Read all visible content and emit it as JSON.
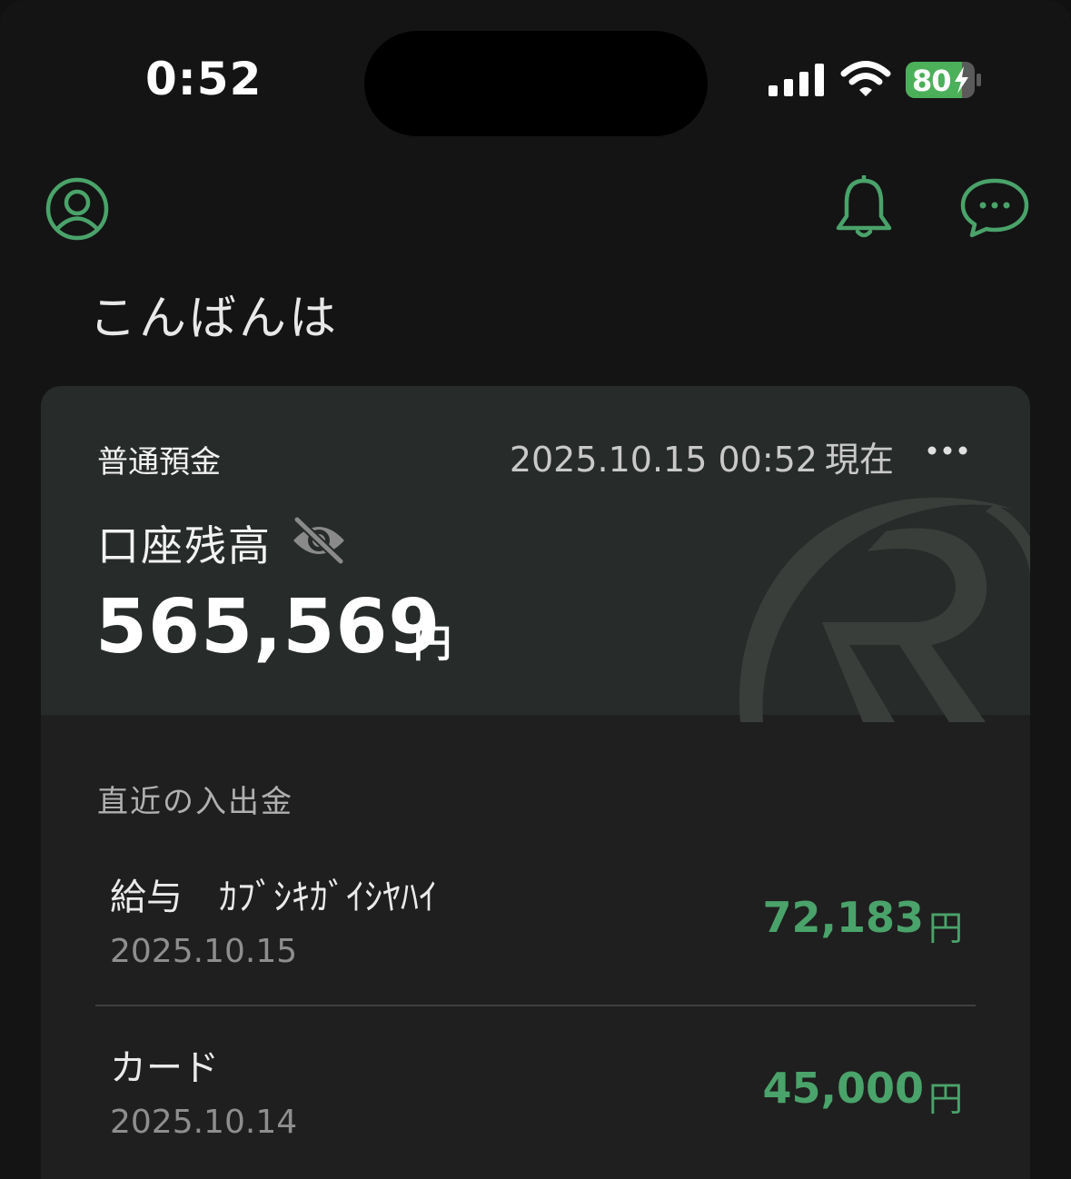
{
  "status_bar": {
    "time": "0:52",
    "battery_level": "80",
    "battery_charging": true
  },
  "header": {
    "greeting": "こんばんは"
  },
  "icons": {
    "profile": "person-circle-icon",
    "notifications": "bell-icon",
    "messages": "chat-bubble-icon",
    "more": "more-dots-icon",
    "hide_balance": "eye-slash-icon"
  },
  "colors": {
    "accent": "#4aa36a",
    "background": "#141414",
    "card_top": "#272b2a",
    "card_body": "#1f1f1f"
  },
  "account": {
    "type": "普通預金",
    "as_of_datetime": "2025.10.15 00:52",
    "as_of_suffix": "現在",
    "balance_label": "口座残高",
    "balance": "565,569",
    "currency": "円"
  },
  "recent": {
    "title": "直近の入出金",
    "transactions": [
      {
        "name": "給与　ｶﾌﾞｼｷｶﾞｲｼﾔﾊｲ",
        "date": "2025.10.15",
        "amount": "72,183",
        "unit": "円"
      },
      {
        "name": "カード",
        "date": "2025.10.14",
        "amount": "45,000",
        "unit": "円"
      }
    ]
  }
}
